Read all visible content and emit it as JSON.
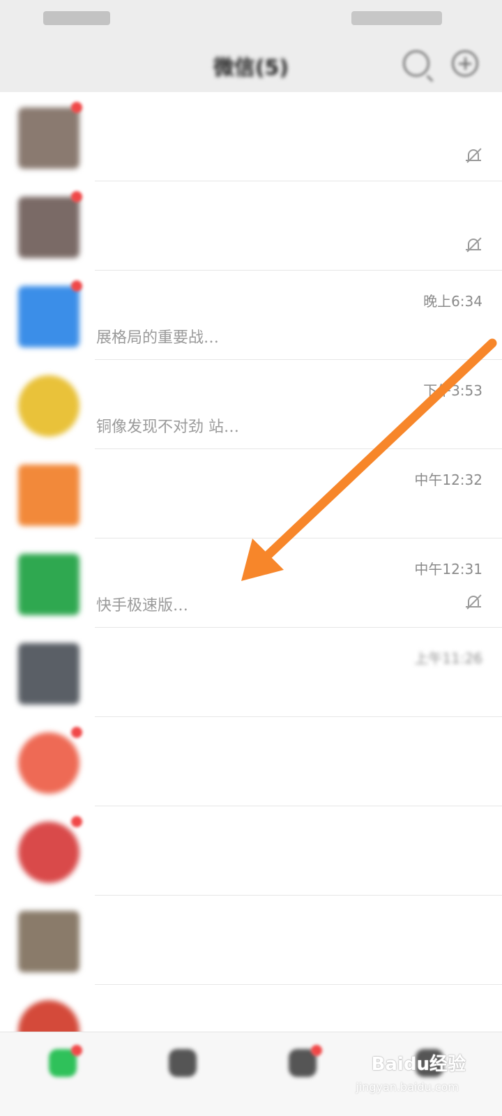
{
  "status_bar": {
    "left": "",
    "right": ""
  },
  "header": {
    "title": "微信(5)"
  },
  "chats": [
    {
      "name": "",
      "time": "",
      "preview_blur": "",
      "preview_clear": "",
      "muted": true,
      "avatar_color": "#8a7a70",
      "badge": true
    },
    {
      "name": "",
      "time": "",
      "preview_blur": "",
      "preview_clear": "",
      "muted": true,
      "avatar_color": "#7a6a66",
      "badge": true
    },
    {
      "name": "",
      "time": "晚上6:34",
      "preview_blur": "",
      "preview_clear": "展格局的重要战…",
      "muted": false,
      "avatar_color": "#3b8ee8",
      "badge": true
    },
    {
      "name": "",
      "time": "下午3:53",
      "preview_blur": "",
      "preview_clear": "铜像发现不对劲 站…",
      "muted": false,
      "avatar_color": "#e9c23a",
      "badge": false
    },
    {
      "name": "",
      "time": "中午12:32",
      "preview_blur": "",
      "preview_clear": "",
      "muted": false,
      "avatar_color": "#f2893a",
      "badge": false
    },
    {
      "name": "",
      "time": "中午12:31",
      "preview_blur": "",
      "preview_clear": "快手极速版…",
      "muted": true,
      "avatar_color": "#2fa850",
      "badge": false
    },
    {
      "name": "",
      "time": "上午11:26",
      "preview_blur": "",
      "preview_clear": "",
      "muted": false,
      "avatar_color": "#5a5f66",
      "badge": false
    },
    {
      "name": "",
      "time": "",
      "preview_blur": "",
      "preview_clear": "",
      "muted": false,
      "avatar_color": "#ee6a55",
      "badge": true
    },
    {
      "name": "",
      "time": "",
      "preview_blur": "",
      "preview_clear": "",
      "muted": false,
      "avatar_color": "#d94a4a",
      "badge": true
    },
    {
      "name": "",
      "time": "",
      "preview_blur": "",
      "preview_clear": "",
      "muted": false,
      "avatar_color": "#8a7b6a",
      "badge": false
    },
    {
      "name": "",
      "time": "",
      "preview_blur": "",
      "preview_clear": "",
      "muted": false,
      "avatar_color": "#d44a3a",
      "badge": false
    }
  ],
  "tabs": [
    {
      "label": "",
      "color": "#2fc15a",
      "badge": true
    },
    {
      "label": "",
      "color": "#555555",
      "badge": false
    },
    {
      "label": "",
      "color": "#555555",
      "badge": true
    },
    {
      "label": "",
      "color": "#555555",
      "badge": false
    }
  ],
  "annotation": {
    "color": "#f7862a"
  },
  "watermark": {
    "text": "Baidu经验",
    "sub": "jingyan.baidu.com"
  }
}
